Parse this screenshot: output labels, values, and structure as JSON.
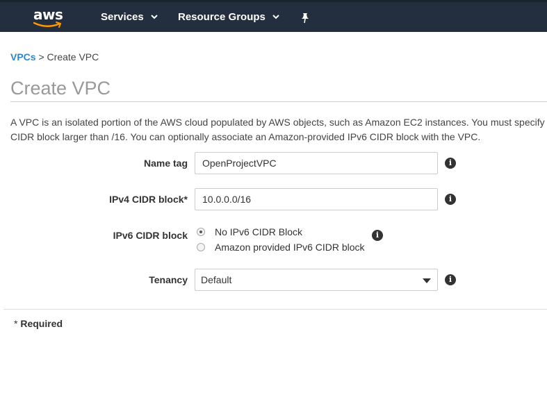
{
  "nav": {
    "logo_text": "aws",
    "services_label": "Services",
    "resource_groups_label": "Resource Groups"
  },
  "breadcrumb": {
    "parent": "VPCs",
    "separator": ">",
    "current": "Create VPC"
  },
  "page": {
    "title": "Create VPC",
    "description_line1": "A VPC is an isolated portion of the AWS cloud populated by AWS objects, such as Amazon EC2 instances. You must specify",
    "description_line2": "CIDR block larger than /16. You can optionally associate an Amazon-provided IPv6 CIDR block with the VPC."
  },
  "form": {
    "name_tag": {
      "label": "Name tag",
      "value": "OpenProjectVPC"
    },
    "ipv4": {
      "label": "IPv4 CIDR block*",
      "value": "10.0.0.0/16"
    },
    "ipv6": {
      "label": "IPv6 CIDR block",
      "options": [
        {
          "label": "No IPv6 CIDR Block",
          "selected": true
        },
        {
          "label": "Amazon provided IPv6 CIDR block",
          "selected": false
        }
      ]
    },
    "tenancy": {
      "label": "Tenancy",
      "value": "Default"
    },
    "info_glyph": "i"
  },
  "footer": {
    "required_star": "*",
    "required_label": "Required"
  },
  "colors": {
    "nav_bg": "#232f3e",
    "link": "#2e86c8",
    "aws_smile": "#ff9900"
  }
}
